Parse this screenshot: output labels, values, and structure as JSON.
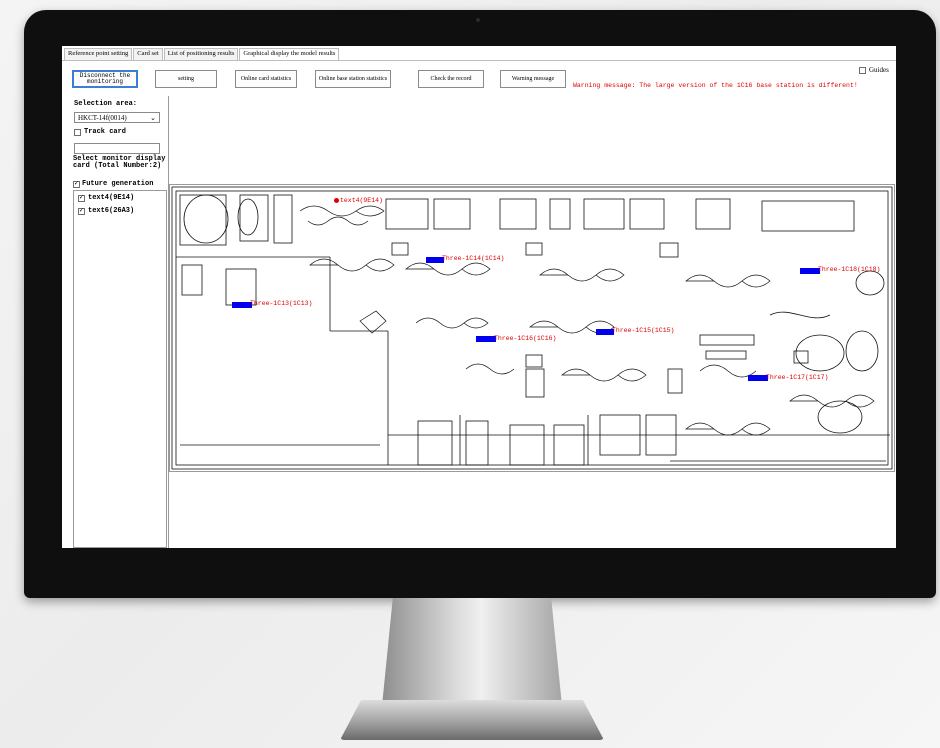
{
  "tabs": [
    {
      "label": "Reference point setting"
    },
    {
      "label": "Card set"
    },
    {
      "label": "List of positioning results"
    },
    {
      "label": "Graphical display the model results",
      "active": true
    }
  ],
  "toolbar": {
    "disconnect": "Disconnect the monitoring",
    "setting": "setting",
    "online_card": "Online card statistics",
    "online_base": "Online base station statistics",
    "check_record": "Check the record",
    "warning_btn": "Warning message",
    "guides": "Guides"
  },
  "warning_text": "Warning message: The large version of the 1C16 base station is different!",
  "left": {
    "selection_area_label": "Selection area:",
    "selected_area": "HKCT-14f(0014)",
    "track_card": "Track card",
    "monitor_label": "Select monitor display card (Total Number:2)",
    "future_generation": "Future generation",
    "cards": [
      {
        "label": "text4(9E14)",
        "checked": true
      },
      {
        "label": "text6(26A3)",
        "checked": true
      }
    ]
  },
  "map": {
    "cards": [
      {
        "label": "text4(9E14)"
      }
    ],
    "stations": [
      {
        "label": "Three-1C14(1C14)"
      },
      {
        "label": "Three-1C18(1C18)"
      },
      {
        "label": "Three-1C13(1C13)"
      },
      {
        "label": "Three-1C16(1C16)"
      },
      {
        "label": "Three-1C15(1C15)"
      },
      {
        "label": "Three-1C17(1C17)"
      }
    ]
  },
  "colors": {
    "warning": "#e20000",
    "station": "#0000ee",
    "label": "#e00000",
    "focus": "#3c7fd1"
  }
}
